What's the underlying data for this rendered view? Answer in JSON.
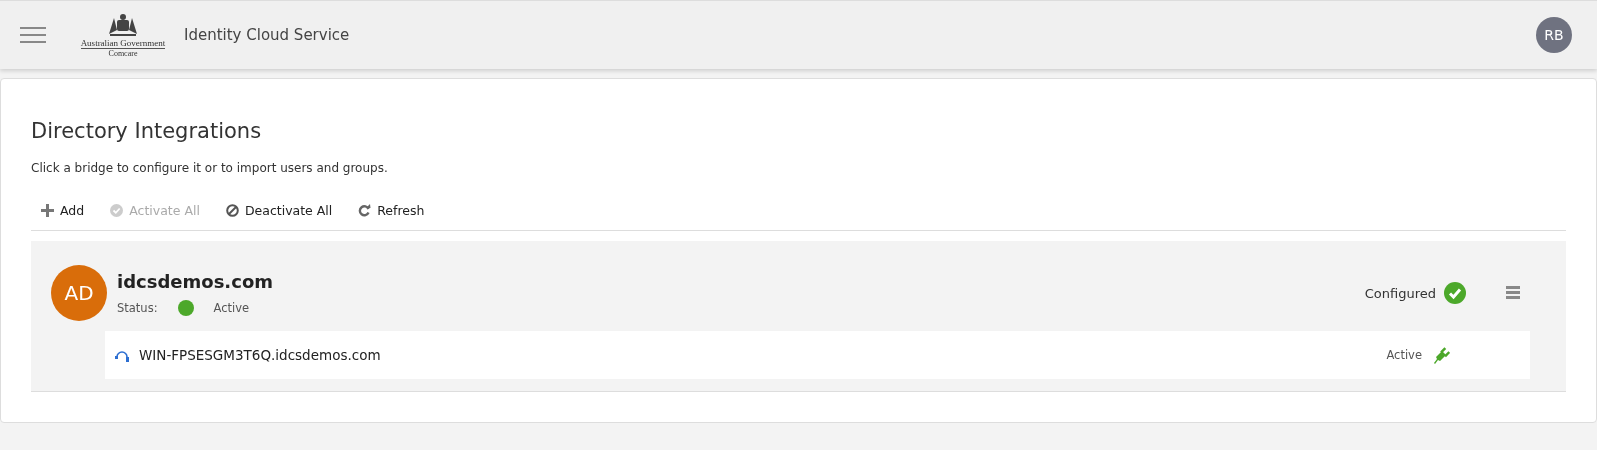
{
  "header": {
    "logo": {
      "line_1": "Australian Government",
      "line_2": "Comcare"
    },
    "app_title": "Identity Cloud Service",
    "user_initials": "RB"
  },
  "page": {
    "title": "Directory Integrations",
    "description": "Click a bridge to configure it or to import users and groups.",
    "actions": [
      {
        "kind": "add",
        "label": "Add",
        "disabled": false
      },
      {
        "kind": "activate",
        "label": "Activate All",
        "disabled": true
      },
      {
        "kind": "deactivate",
        "label": "Deactivate All",
        "disabled": false
      },
      {
        "kind": "refresh",
        "label": "Refresh",
        "disabled": false
      }
    ],
    "bridges": [
      {
        "initials": "AD",
        "name": "idcsdemos.com",
        "status_label": "Status:",
        "status": "Active",
        "active": true,
        "configured_label": "Configured",
        "configured": true,
        "agents": [
          {
            "host": "WIN-FPSESGM3T6Q.idcsdemos.com",
            "status": "Active",
            "connected": true
          }
        ]
      }
    ]
  }
}
